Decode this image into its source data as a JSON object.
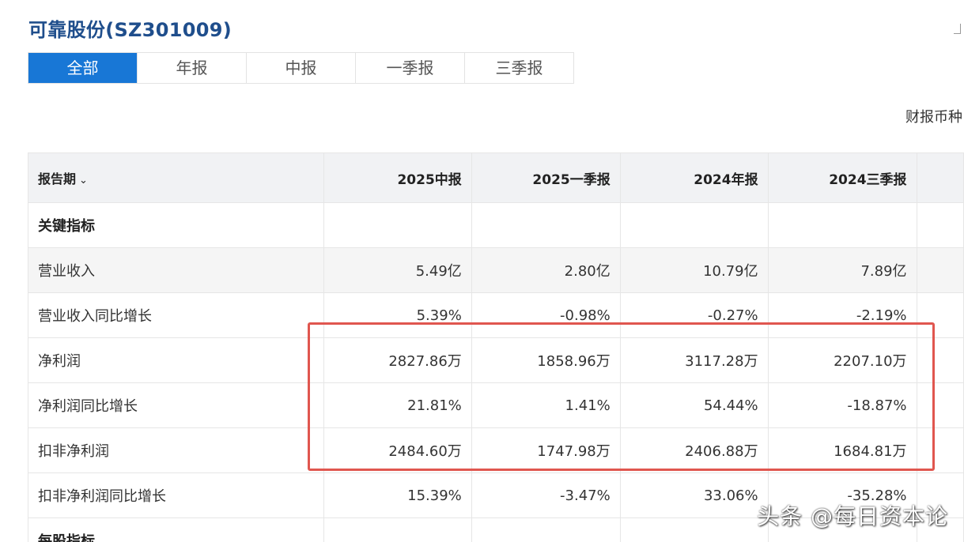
{
  "title": "可靠股份(SZ301009)",
  "tabs": [
    {
      "label": "全部",
      "active": true
    },
    {
      "label": "年报",
      "active": false
    },
    {
      "label": "中报",
      "active": false
    },
    {
      "label": "一季报",
      "active": false
    },
    {
      "label": "三季报",
      "active": false
    }
  ],
  "currency_label": "财报币种",
  "table": {
    "period_header": "报告期",
    "columns": [
      "2025中报",
      "2025一季报",
      "2024年报",
      "2024三季报"
    ],
    "sections": {
      "key_indicators": "关键指标",
      "per_share": "每股指标"
    },
    "rows": [
      {
        "label": "营业收入",
        "values": [
          "5.49亿",
          "2.80亿",
          "10.79亿",
          "7.89亿"
        ]
      },
      {
        "label": "营业收入同比增长",
        "values": [
          "5.39%",
          "-0.98%",
          "-0.27%",
          "-2.19%"
        ]
      },
      {
        "label": "净利润",
        "values": [
          "2827.86万",
          "1858.96万",
          "3117.28万",
          "2207.10万"
        ]
      },
      {
        "label": "净利润同比增长",
        "values": [
          "21.81%",
          "1.41%",
          "54.44%",
          "-18.87%"
        ]
      },
      {
        "label": "扣非净利润",
        "values": [
          "2484.60万",
          "1747.98万",
          "2406.88万",
          "1684.81万"
        ]
      },
      {
        "label": "扣非净利润同比增长",
        "values": [
          "15.39%",
          "-3.47%",
          "33.06%",
          "-35.28%"
        ]
      }
    ]
  },
  "watermark": "头条 @每日资本论",
  "colors": {
    "accent": "#1877d6",
    "title": "#1f4e8c",
    "highlight": "#e0564f"
  }
}
